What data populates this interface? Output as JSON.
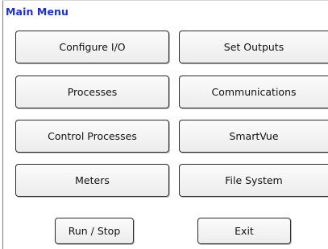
{
  "title": "Main Menu",
  "buttons": {
    "configure_io": "Configure I/O",
    "set_outputs": "Set Outputs",
    "processes": "Processes",
    "communications": "Communications",
    "control_processes": "Control Processes",
    "smartvue": "SmartVue",
    "meters": "Meters",
    "file_system": "File System",
    "run_stop": "Run / Stop",
    "exit": "Exit"
  },
  "colors": {
    "title": "#1c2fc7",
    "button_border": "#2b2b2b",
    "button_fill": "#f5f5f5"
  }
}
